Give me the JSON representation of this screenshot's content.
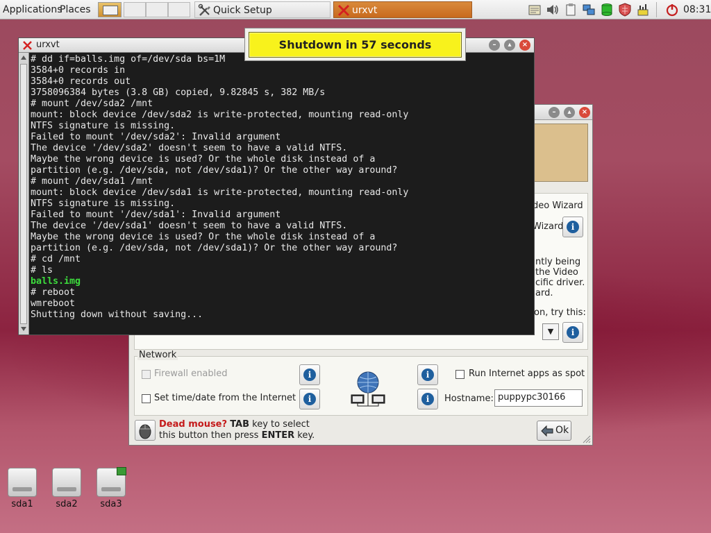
{
  "taskbar": {
    "menu_applications": "Applications",
    "menu_places": "Places",
    "tasks": [
      {
        "label": "Quick Setup",
        "icon": "tools-icon",
        "active": false
      },
      {
        "label": "urxvt",
        "icon": "x-icon",
        "active": true
      }
    ],
    "tray_icons": [
      "notes-icon",
      "volume-icon",
      "clipboard-icon",
      "network-icon",
      "drive-icon",
      "firewall-icon",
      "power-icon"
    ],
    "clock": "08:31"
  },
  "terminal": {
    "title": "urxvt",
    "lines": [
      {
        "text": "# dd if=balls.img of=/dev/sda bs=1M",
        "style": "normal"
      },
      {
        "text": "3584+0 records in",
        "style": "normal"
      },
      {
        "text": "3584+0 records out",
        "style": "normal"
      },
      {
        "text": "3758096384 bytes (3.8 GB) copied, 9.82845 s, 382 MB/s",
        "style": "normal"
      },
      {
        "text": "# mount /dev/sda2 /mnt",
        "style": "normal"
      },
      {
        "text": "mount: block device /dev/sda2 is write-protected, mounting read-only",
        "style": "normal"
      },
      {
        "text": "NTFS signature is missing.",
        "style": "normal"
      },
      {
        "text": "Failed to mount '/dev/sda2': Invalid argument",
        "style": "normal"
      },
      {
        "text": "The device '/dev/sda2' doesn't seem to have a valid NTFS.",
        "style": "normal"
      },
      {
        "text": "Maybe the wrong device is used? Or the whole disk instead of a",
        "style": "normal"
      },
      {
        "text": "partition (e.g. /dev/sda, not /dev/sda1)? Or the other way around?",
        "style": "normal"
      },
      {
        "text": "# mount /dev/sda1 /mnt",
        "style": "normal"
      },
      {
        "text": "mount: block device /dev/sda1 is write-protected, mounting read-only",
        "style": "normal"
      },
      {
        "text": "NTFS signature is missing.",
        "style": "normal"
      },
      {
        "text": "Failed to mount '/dev/sda1': Invalid argument",
        "style": "normal"
      },
      {
        "text": "The device '/dev/sda1' doesn't seem to have a valid NTFS.",
        "style": "normal"
      },
      {
        "text": "Maybe the wrong device is used? Or the whole disk instead of a",
        "style": "normal"
      },
      {
        "text": "partition (e.g. /dev/sda, not /dev/sda1)? Or the other way around?",
        "style": "normal"
      },
      {
        "text": "# cd /mnt",
        "style": "normal"
      },
      {
        "text": "# ls",
        "style": "normal"
      },
      {
        "text": "balls.img",
        "style": "green"
      },
      {
        "text": "# reboot",
        "style": "normal"
      },
      {
        "text": "wmreboot",
        "style": "normal"
      },
      {
        "text": "Shutting down without saving...",
        "style": "normal"
      }
    ]
  },
  "shutdown_notice": {
    "text": "Shutdown in 57 seconds"
  },
  "quick_setup": {
    "fragments": {
      "video_wizard_1": "deo Wizard",
      "video_wizard_2": "Wizard",
      "being_1": "ntly being",
      "being_2": "the Video",
      "being_3": "cific driver.",
      "being_4": "ard.",
      "try_this": "on, try this:"
    },
    "network": {
      "legend": "Network",
      "firewall_label": "Firewall enabled",
      "firewall_checked": false,
      "firewall_disabled": true,
      "time_label": "Set time/date from the Internet",
      "time_checked": false,
      "spot_label": "Run Internet apps as spot",
      "spot_checked": false,
      "hostname_label": "Hostname:",
      "hostname_value": "puppypc30166"
    },
    "tip": {
      "lead": "Dead mouse?",
      "key1": "TAB",
      "mid": "key to select",
      "line2_start": "this button then press",
      "key2": "ENTER",
      "line2_end": "key."
    },
    "ok_label": "Ok"
  },
  "desktop": {
    "drives": [
      {
        "label": "sda1",
        "mounted": false
      },
      {
        "label": "sda2",
        "mounted": false
      },
      {
        "label": "sda3",
        "mounted": true
      }
    ]
  }
}
